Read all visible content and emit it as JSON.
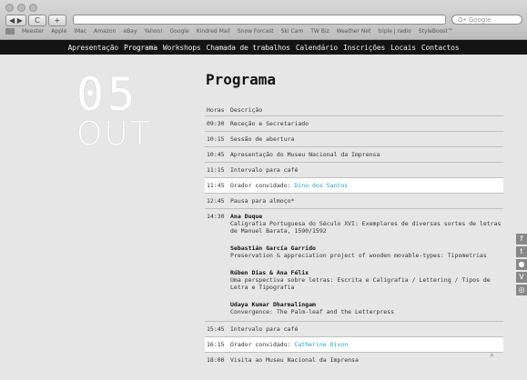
{
  "browser": {
    "nav_back": "◀ ▶",
    "nav_reload": "C",
    "nav_add": "+",
    "url_text": "",
    "search_placeholder": "Q• Google",
    "bookmarks": [
      "Meester",
      "Apple",
      "iMac",
      "Amazon",
      "eBay",
      "Yahoo!",
      "Google",
      "Kindred Mail",
      "Snow Forcast",
      "Ski Cam",
      "TW Biz",
      "Weather Net",
      "triple j radio",
      "StyleBoost™"
    ]
  },
  "sitenav": [
    "Apresentação",
    "Programa",
    "Workshops",
    "Chamada de trabalhos",
    "Calendário",
    "Inscrições",
    "Locais",
    "Contactos"
  ],
  "date": {
    "day": "05",
    "month": "OUT"
  },
  "page_title": "Programa",
  "table": {
    "headers": [
      "Horas",
      "Descrição"
    ],
    "rows": [
      {
        "time": "09:30",
        "text": "Receção e Secretariado"
      },
      {
        "time": "10:15",
        "text": "Sessão de abertura"
      },
      {
        "time": "10:45",
        "text": "Apresentação do Museu Nacional da Imprensa"
      },
      {
        "time": "11:15",
        "text": "Intervalo para café"
      },
      {
        "time": "11:45",
        "text": "Orador convidado: ",
        "link": "Dino dos Santos"
      },
      {
        "time": "12:45",
        "text": "Pausa para almoço*"
      },
      {
        "time": "14:30",
        "entries": [
          {
            "name": "Ana Duque",
            "talk": "Caligrafia Portuguesa do Século XVI: Exemplares de diversas sortes de letras de Manuel Barata, 1590/1592"
          },
          {
            "name": "Sebastián García Garrido",
            "talk": "Preservation & appreciation project of wooden movable-types: Tipometrias"
          },
          {
            "name": "Rúben Dias & Ana Félix",
            "talk": "Uma perspectiva sobre letras: Escrita e Caligrafia / Lettering / Tipos de Letra e Tipografia"
          },
          {
            "name": "Udaya Kumar Dharmalingam",
            "talk": "Convergence: The Palm-leaf and the Letterpress"
          }
        ]
      },
      {
        "time": "15:45",
        "text": "Intervalo para café"
      },
      {
        "time": "16:15",
        "text": "Orador convidado: ",
        "link": "Catherine Dixon"
      },
      {
        "time": "18:00",
        "text": "Visita ao Museu Nacional da Imprensa"
      }
    ]
  },
  "side_icons": [
    "f",
    "t",
    "●",
    "V",
    "◎"
  ],
  "colors": {
    "accent": "#1aa3d0",
    "nav_bg": "#141414",
    "page_bg": "#e6e6e6"
  }
}
